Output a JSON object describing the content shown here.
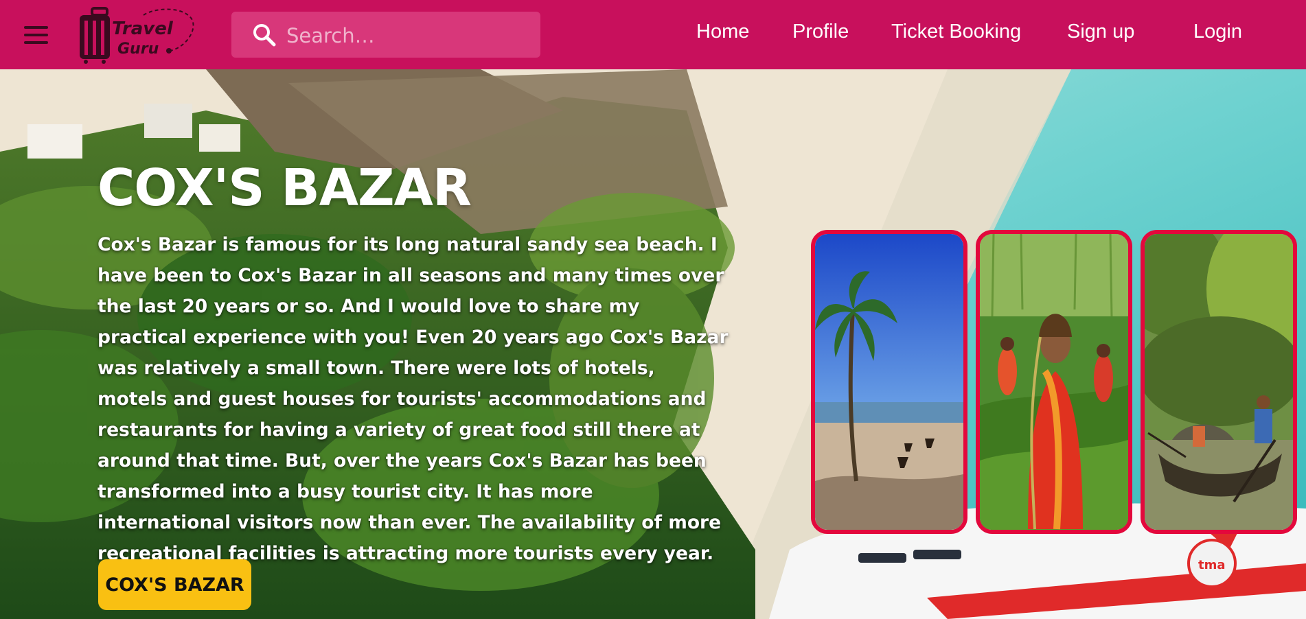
{
  "header": {
    "logo_text_line1": "Travel",
    "logo_text_line2": "Guru",
    "search_placeholder": "Search…",
    "nav": [
      "Home",
      "Profile",
      "Ticket Booking",
      "Sign up",
      "Login"
    ]
  },
  "hero": {
    "title": "COX'S BAZAR",
    "description": "Cox's Bazar is famous for its long natural sandy sea beach. I have been to Cox's Bazar in all seasons and many times over the last 20 years or so. And I would love to share my practical experience with you! Even 20 years ago Cox's Bazar was relatively a small town. There were lots of hotels, motels and guest houses for tourists' accommodations and restaurants for having a variety of great food still there at around that time. But, over the years Cox's Bazar has been transformed into a busy tourist city. It has more international visitors now than ever. The availability of more recreational facilities is attracting more tourists every year.",
    "button_label": "COX'S BAZAR",
    "plane_badge": "tma"
  },
  "icons": {
    "menu": "hamburger-menu-icon",
    "search": "search-icon",
    "logo": "suitcase-logo-icon"
  },
  "colors": {
    "header_bg": "#c8105c",
    "search_bg": "#d8377a",
    "button_bg": "#f9c012",
    "card_border": "#e3083c"
  }
}
